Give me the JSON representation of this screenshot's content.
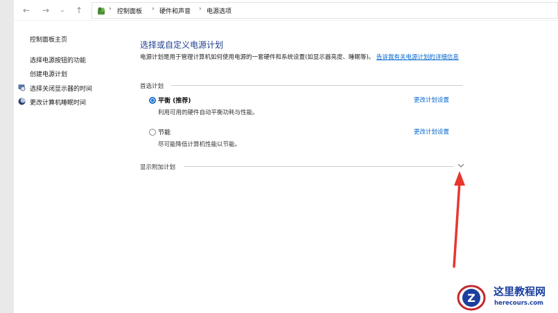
{
  "nav": {
    "back": "←",
    "forward": "→",
    "recent": "⌄",
    "up": "↑"
  },
  "breadcrumb": {
    "items": [
      "控制面板",
      "硬件和声音",
      "电源选项"
    ],
    "separator": "›"
  },
  "sidebar": {
    "home": "控制面板主页",
    "links": [
      "选择电源按钮的功能",
      "创建电源计划",
      "选择关闭显示器的时间",
      "更改计算机睡眠时间"
    ]
  },
  "main": {
    "title": "选择或自定义电源计划",
    "description": "电源计划是用于管理计算机如何使用电源的一套硬件和系统设置(如显示器亮度、睡眠等)。",
    "description_link": "告诉我有关电源计划的详细信息",
    "preferred_label": "首选计划",
    "plans": [
      {
        "name": "平衡 (推荐)",
        "desc": "利用可用的硬件自动平衡功耗与性能。",
        "link": "更改计划设置",
        "selected": true
      },
      {
        "name": "节能",
        "desc": "尽可能降低计算机性能以节能。",
        "link": "更改计划设置",
        "selected": false
      }
    ],
    "extra_label": "显示附加计划"
  },
  "annotation": {
    "arrow_color": "#e8352e"
  },
  "watermark": {
    "title": "这里教程网",
    "url": "herecours.com"
  },
  "colors": {
    "accent": "#1a6fcf",
    "link": "#0066cc",
    "title": "#1e3f8f"
  }
}
